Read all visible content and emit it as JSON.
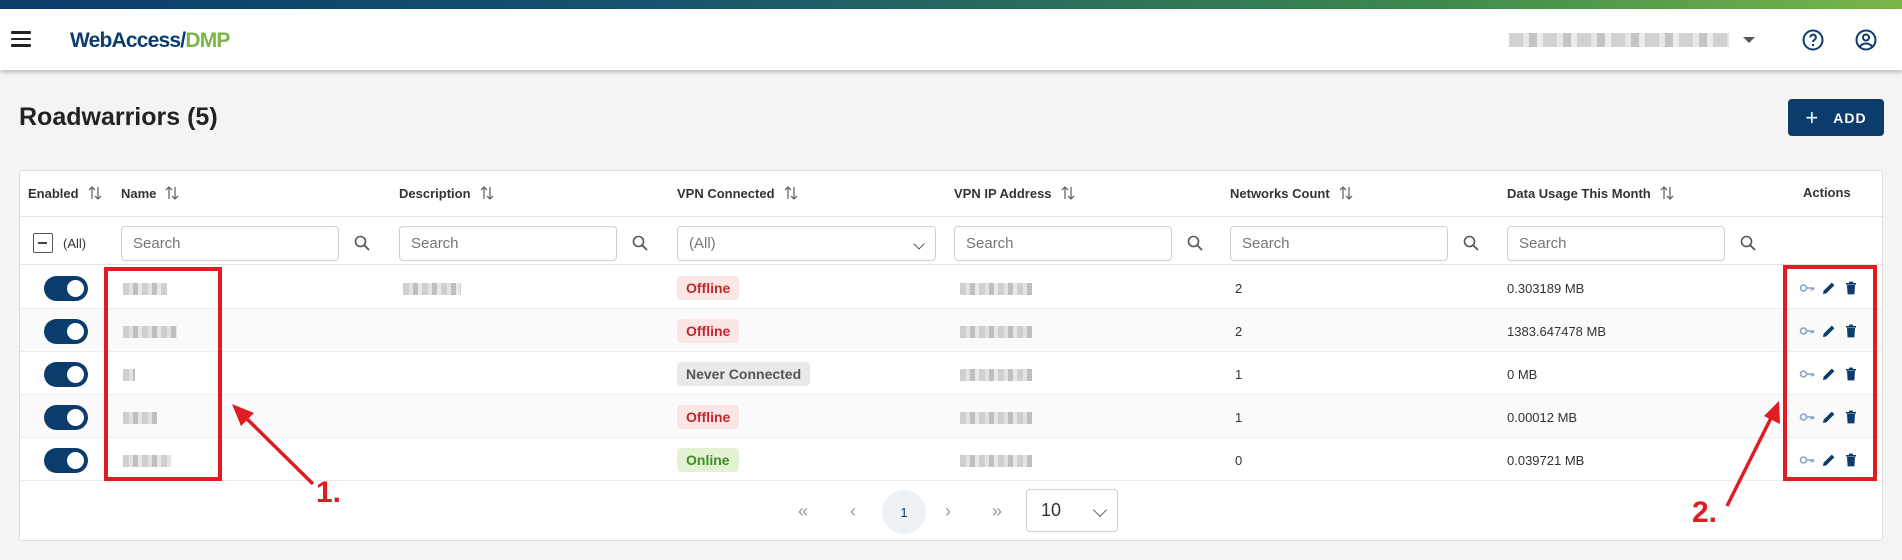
{
  "app": {
    "logo_part1": "WebAccess/",
    "logo_part2": "DMP"
  },
  "page": {
    "title": "Roadwarriors (5)",
    "add_label": "ADD"
  },
  "columns": {
    "enabled": "Enabled",
    "name": "Name",
    "description": "Description",
    "vpn_connected": "VPN Connected",
    "vpn_ip": "VPN IP Address",
    "networks_count": "Networks Count",
    "data_usage": "Data Usage This Month",
    "actions": "Actions"
  },
  "filters": {
    "all_label": "(All)",
    "search_placeholder": "Search",
    "vpn_select_value": "(All)"
  },
  "rows": [
    {
      "status": "Offline",
      "networks": "2",
      "usage": "0.303189 MB"
    },
    {
      "status": "Offline",
      "networks": "2",
      "usage": "1383.647478 MB"
    },
    {
      "status": "Never Connected",
      "networks": "1",
      "usage": "0 MB"
    },
    {
      "status": "Offline",
      "networks": "1",
      "usage": "0.00012 MB"
    },
    {
      "status": "Online",
      "networks": "0",
      "usage": "0.039721 MB"
    }
  ],
  "pagination": {
    "current_page": "1",
    "page_size": "10"
  },
  "annotations": {
    "callout_1": "1.",
    "callout_2": "2."
  },
  "colors": {
    "primary": "#0b3c6b",
    "accent_green": "#7ab648",
    "annotation_red": "#e01b22"
  }
}
